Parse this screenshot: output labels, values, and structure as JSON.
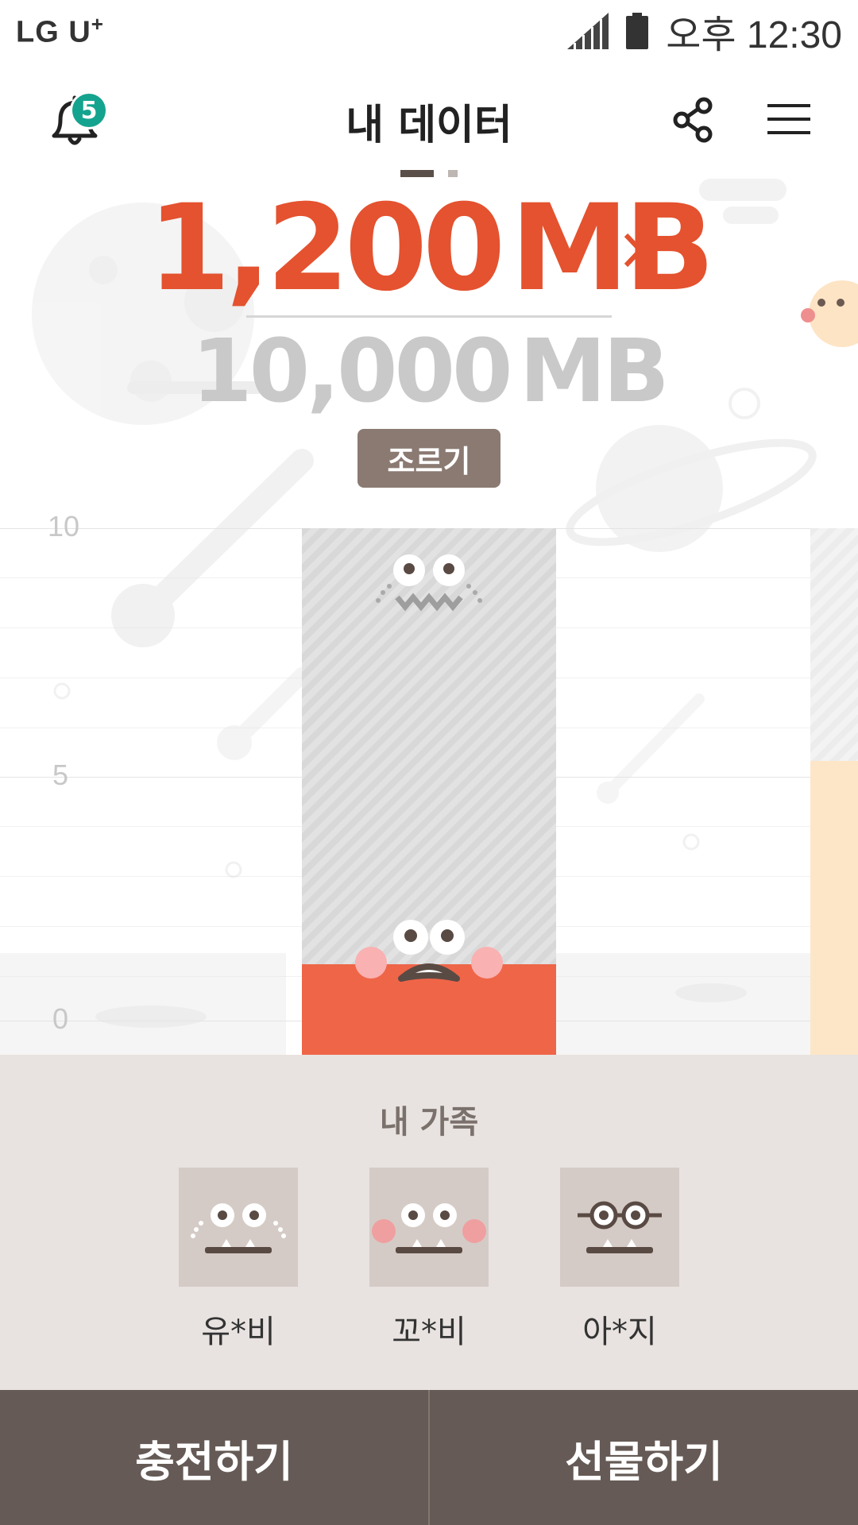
{
  "status_bar": {
    "carrier": "LG U",
    "carrier_plus": "+",
    "time": "오후 12:30",
    "signal_icon": "signal-icon",
    "battery_icon": "battery-icon"
  },
  "header": {
    "title": "내 데이터",
    "notification_count": "5",
    "bell_icon": "bell-icon",
    "share_icon": "share-icon",
    "menu_icon": "menu-icon"
  },
  "pager": {
    "pages": 2,
    "current": 1
  },
  "usage": {
    "used": "1,200",
    "used_unit": "MB",
    "total": "10,000",
    "total_unit": "MB",
    "used_color": "#e4522f"
  },
  "save_button": "조르기",
  "chart_data": {
    "type": "bar",
    "yticks": [
      "10",
      "5",
      "0"
    ],
    "ylim": [
      0,
      10
    ],
    "remaining_ratio": 0.12,
    "bar_color": "#ef6548",
    "track_color": "#dddddd"
  },
  "family": {
    "title": "내 가족",
    "members": [
      {
        "name": "유*비",
        "avatar_icon": "face-dots-icon"
      },
      {
        "name": "꼬*비",
        "avatar_icon": "face-blush-icon"
      },
      {
        "name": "아*지",
        "avatar_icon": "face-glasses-icon"
      }
    ]
  },
  "bottom_buttons": {
    "charge": "충전하기",
    "gift": "선물하기"
  }
}
